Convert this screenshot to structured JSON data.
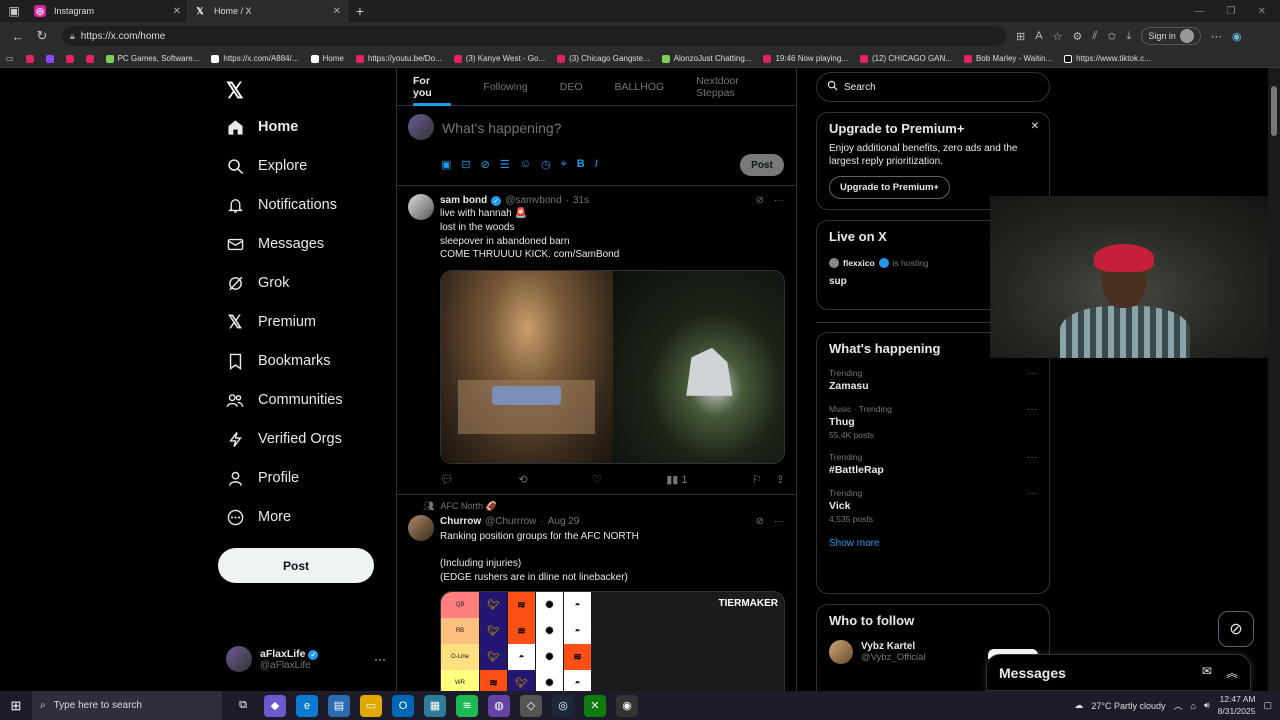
{
  "browser": {
    "tabs": [
      {
        "title": "Instagram",
        "active": false
      },
      {
        "title": "Home / X",
        "active": true
      }
    ],
    "url": "https://x.com/home",
    "signin_label": "Sign in",
    "bookmarks": [
      "PC Games, Software...",
      "https://x.com/A884/...",
      "Home",
      "https://youtu.be/Do...",
      "(3) Kanye West - Go...",
      "(3) Chicago Gangste...",
      "AlonzoJust Chatting...",
      "19:46 Now playing...",
      "(12) CHICAGO GAN...",
      "Bob Marley - Waitin...",
      "https://www.tiktok.c..."
    ]
  },
  "nav": {
    "items": [
      {
        "label": "Home",
        "icon": "home-icon"
      },
      {
        "label": "Explore",
        "icon": "search-icon"
      },
      {
        "label": "Notifications",
        "icon": "bell-icon"
      },
      {
        "label": "Messages",
        "icon": "envelope-icon"
      },
      {
        "label": "Grok",
        "icon": "grok-icon"
      },
      {
        "label": "Premium",
        "icon": "x-icon"
      },
      {
        "label": "Bookmarks",
        "icon": "bookmark-icon"
      },
      {
        "label": "Communities",
        "icon": "people-icon"
      },
      {
        "label": "Verified Orgs",
        "icon": "lightning-icon"
      },
      {
        "label": "Profile",
        "icon": "person-icon"
      },
      {
        "label": "More",
        "icon": "more-circle-icon"
      }
    ],
    "post_label": "Post",
    "account": {
      "name": "aFlaxLife",
      "handle": "@aFlaxLife"
    }
  },
  "feed": {
    "tabs": [
      "For you",
      "Following",
      "DEO",
      "BALLHOG",
      "Nextdoor Steppas"
    ],
    "compose_placeholder": "What's happening?",
    "compose_post": "Post",
    "tweets": [
      {
        "name": "sam bond",
        "handle": "@samvbond",
        "time": "31s",
        "lines": [
          "live with hannah 🚨",
          "lost in the woods",
          "sleepover in abandoned barn",
          "COME THRUUUU KICK. com/SamBond"
        ],
        "views": "1"
      },
      {
        "context": "AFC North 🏈",
        "name": "Churrow",
        "handle": "@Churrrow",
        "time": "Aug 29",
        "lines": [
          "Ranking position groups for the AFC NORTH",
          "",
          "(Including injuries)",
          "(EDGE rushers are in dline not linebacker)"
        ],
        "tier_brand": "TIERMAKER",
        "tier_rows": [
          "QB",
          "RB",
          "O-Line",
          "WR"
        ]
      }
    ]
  },
  "sidebar": {
    "search_placeholder": "Search",
    "premium": {
      "title": "Upgrade to Premium+",
      "body": "Enjoy additional benefits, zero ads and the largest reply prioritization.",
      "button": "Upgrade to Premium+"
    },
    "live": {
      "title": "Live on X",
      "host": "flexxico",
      "host_suffix": "is hosting",
      "space_title": "sup"
    },
    "happening": {
      "title": "What's happening",
      "trends": [
        {
          "meta": "Trending",
          "topic": "Zamasu",
          "count": ""
        },
        {
          "meta": "Music · Trending",
          "topic": "Thug",
          "count": "55.4K posts"
        },
        {
          "meta": "Trending",
          "topic": "#BattleRap",
          "count": ""
        },
        {
          "meta": "Trending",
          "topic": "Vick",
          "count": "4,535 posts"
        }
      ],
      "show_more": "Show more"
    },
    "follow": {
      "title": "Who to follow",
      "users": [
        {
          "name": "Vybz Kartel",
          "handle": "@Vybz_Official"
        }
      ]
    }
  },
  "messages_dock": {
    "title": "Messages"
  },
  "taskbar": {
    "search_placeholder": "Type here to search",
    "weather": "27°C  Partly cloudy",
    "time": "12:47 AM",
    "date": "8/31/2025"
  },
  "colors": {
    "accent": "#1d9bf0",
    "background": "#000000",
    "border": "#2f3336",
    "muted": "#71767b"
  }
}
